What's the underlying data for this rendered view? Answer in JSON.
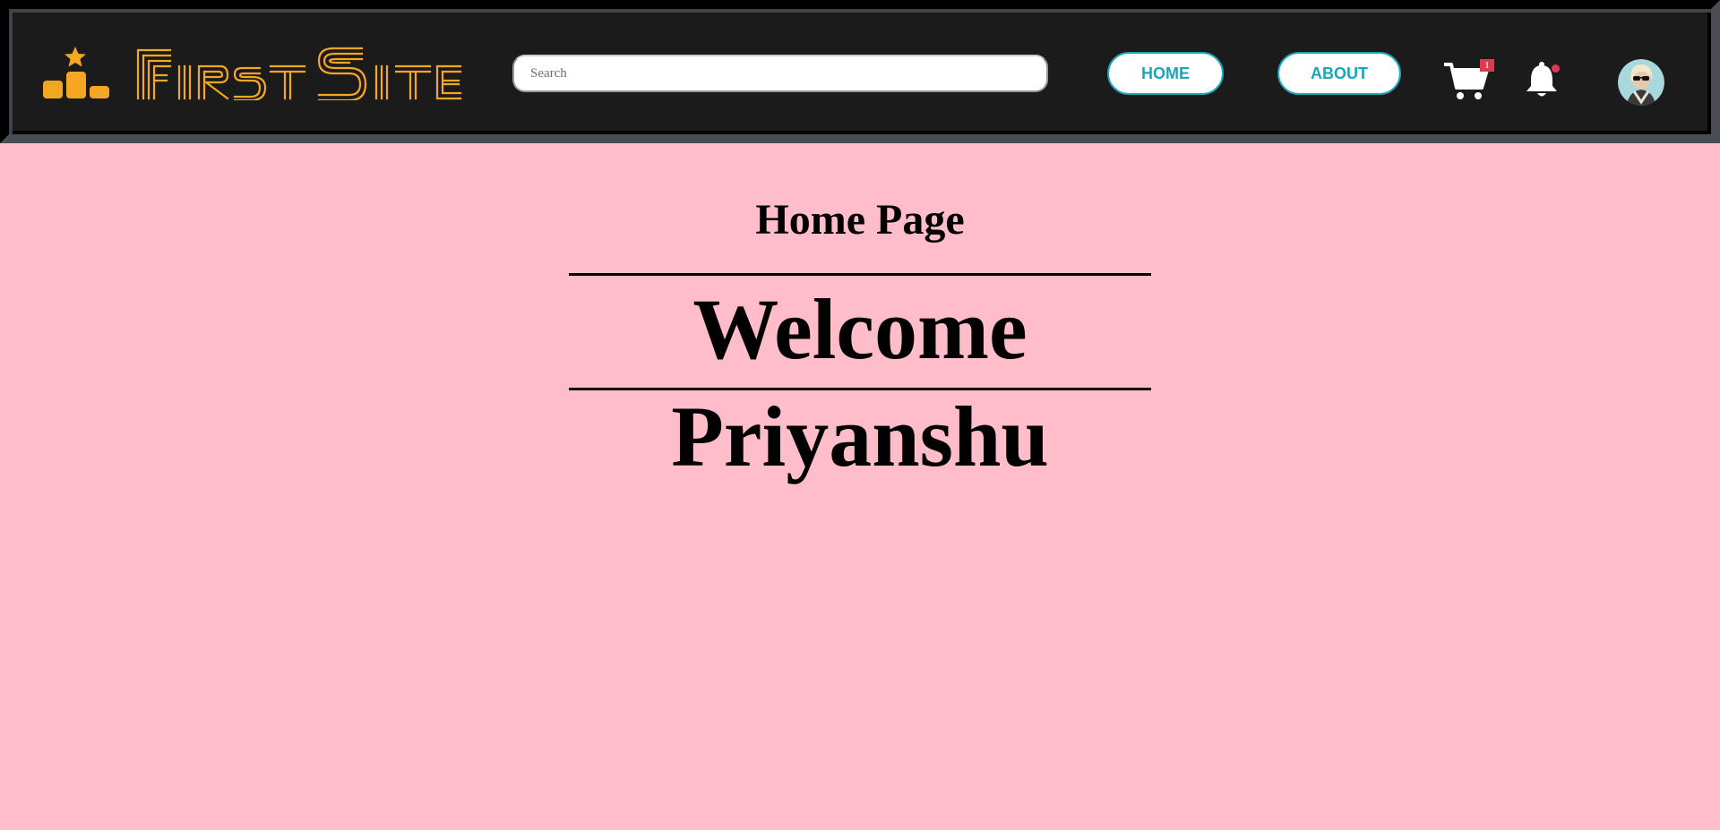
{
  "header": {
    "logo_text": "First Site",
    "search": {
      "placeholder": "Search",
      "value": ""
    },
    "nav": [
      {
        "label": "HOME"
      },
      {
        "label": "ABOUT"
      }
    ],
    "cart": {
      "icon": "cart-icon",
      "count": "1"
    },
    "notifications": {
      "icon": "bell-icon",
      "has_unread": true
    },
    "profile": {
      "icon": "avatar"
    }
  },
  "main": {
    "page_title": "Home Page",
    "welcome": "Welcome",
    "user_name": "Priyanshu"
  },
  "colors": {
    "page_background": "#ffbdca",
    "navbar_background": "#1b1b1b",
    "brand_accent": "#f5a623",
    "nav_button_accent": "#1aa6b7",
    "badge": "#e0394f"
  }
}
